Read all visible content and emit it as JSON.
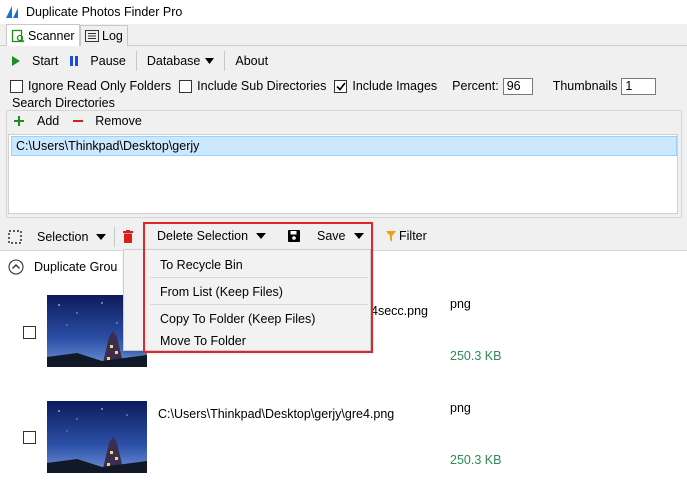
{
  "window": {
    "title": "Duplicate Photos Finder Pro"
  },
  "tabs": [
    {
      "label": "Scanner"
    },
    {
      "label": "Log"
    }
  ],
  "toolbar": {
    "start": "Start",
    "pause": "Pause",
    "database": "Database",
    "about": "About"
  },
  "options": {
    "ignore_read_only": "Ignore Read Only Folders",
    "include_sub_dirs": "Include Sub Directories",
    "include_images": "Include Images",
    "percent_label": "Percent:",
    "percent_value": "96",
    "thumbnails_label": "Thumbnails",
    "thumbnails_value": "1"
  },
  "search": {
    "title": "Search Directories",
    "add": "Add",
    "remove": "Remove",
    "directories": [
      "C:\\Users\\Thinkpad\\Desktop\\gerjy"
    ]
  },
  "selection_toolbar": {
    "selection": "Selection",
    "delete_selection": "Delete Selection",
    "save": "Save",
    "filter": "Filter"
  },
  "dropdown": {
    "items": [
      "To Recycle Bin",
      "From List (Keep Files)",
      "Copy To Folder (Keep Files)",
      "Move To Folder"
    ]
  },
  "results": {
    "group_label": "Duplicate Grou",
    "rows": [
      {
        "path": "4secc.png",
        "type": "png",
        "size": "250.3 KB"
      },
      {
        "path": "C:\\Users\\Thinkpad\\Desktop\\gerjy\\gre4.png",
        "type": "png",
        "size": "250.3 KB"
      }
    ]
  },
  "colors": {
    "accent_green": "#1e8c1e",
    "accent_blue": "#1a4fd1",
    "danger_red": "#d62020",
    "size_green": "#2e8b57",
    "highlight": "#e0252b"
  }
}
